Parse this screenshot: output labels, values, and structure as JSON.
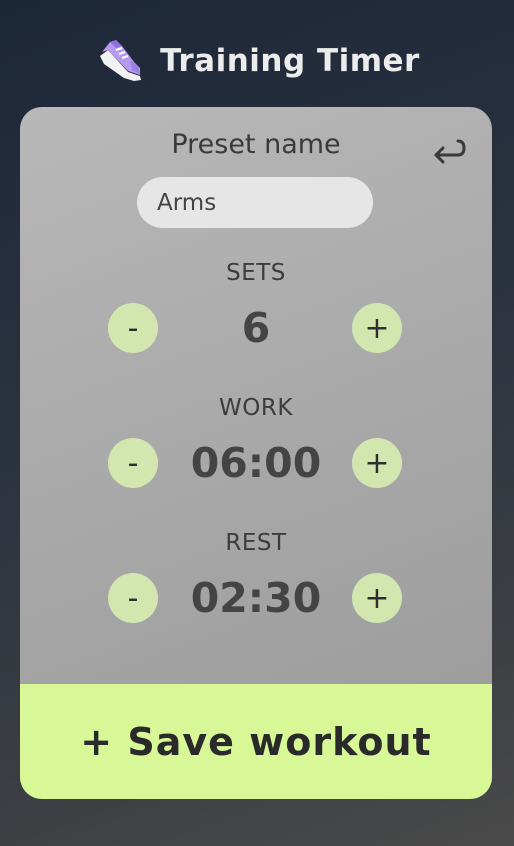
{
  "header": {
    "title": "Training Timer",
    "icon": "running-shoe-icon"
  },
  "preset": {
    "label": "Preset name",
    "value": "Arms"
  },
  "rows": [
    {
      "label": "SETS",
      "value": "6",
      "minus": "-",
      "plus": "+"
    },
    {
      "label": "WORK",
      "value": "06:00",
      "minus": "-",
      "plus": "+"
    },
    {
      "label": "REST",
      "value": "02:30",
      "minus": "-",
      "plus": "+"
    }
  ],
  "save_button": {
    "label": "+ Save workout"
  },
  "colors": {
    "accent": "#d8f898",
    "stepper": "#d4e6b0",
    "card": "#a8a8a8",
    "shoe": "#b59af0"
  }
}
